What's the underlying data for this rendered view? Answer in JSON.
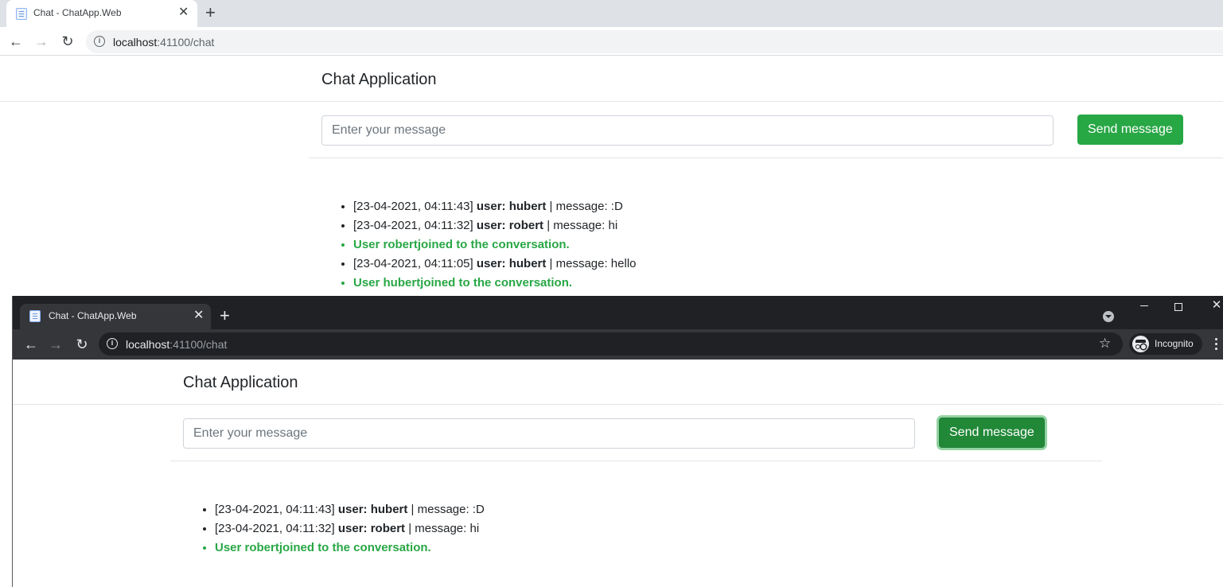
{
  "colors": {
    "accent_green": "#28a745",
    "light_tabstrip": "#dee1e6",
    "dark_tabstrip": "#202124",
    "dark_toolbar": "#35363a"
  },
  "window_main": {
    "tab": {
      "title": "Chat - ChatApp.Web",
      "favicon": "page-icon"
    },
    "address": {
      "host": "localhost",
      "rest": ":41100/chat"
    },
    "app": {
      "brand": "Chat Application",
      "input_placeholder": "Enter your message",
      "send_label": "Send message",
      "messages": [
        {
          "type": "msg",
          "time": "[23-04-2021, 04:11:43]",
          "user": "user: hubert",
          "text": "| message: :D"
        },
        {
          "type": "msg",
          "time": "[23-04-2021, 04:11:32]",
          "user": "user: robert",
          "text": "| message: hi"
        },
        {
          "type": "join",
          "text": "User robertjoined to the conversation."
        },
        {
          "type": "msg",
          "time": "[23-04-2021, 04:11:05]",
          "user": "user: hubert",
          "text": "| message: hello"
        },
        {
          "type": "join",
          "text": "User hubertjoined to the conversation."
        }
      ]
    }
  },
  "window_incognito": {
    "tab": {
      "title": "Chat - ChatApp.Web",
      "favicon": "page-icon"
    },
    "address": {
      "host": "localhost",
      "rest": ":41100/chat"
    },
    "incognito_label": "Incognito",
    "app": {
      "brand": "Chat Application",
      "input_placeholder": "Enter your message",
      "send_label": "Send message",
      "messages": [
        {
          "type": "msg",
          "time": "[23-04-2021, 04:11:43]",
          "user": "user: hubert",
          "text": "| message: :D"
        },
        {
          "type": "msg",
          "time": "[23-04-2021, 04:11:32]",
          "user": "user: robert",
          "text": "| message: hi"
        },
        {
          "type": "join",
          "text": "User robertjoined to the conversation."
        }
      ]
    }
  }
}
